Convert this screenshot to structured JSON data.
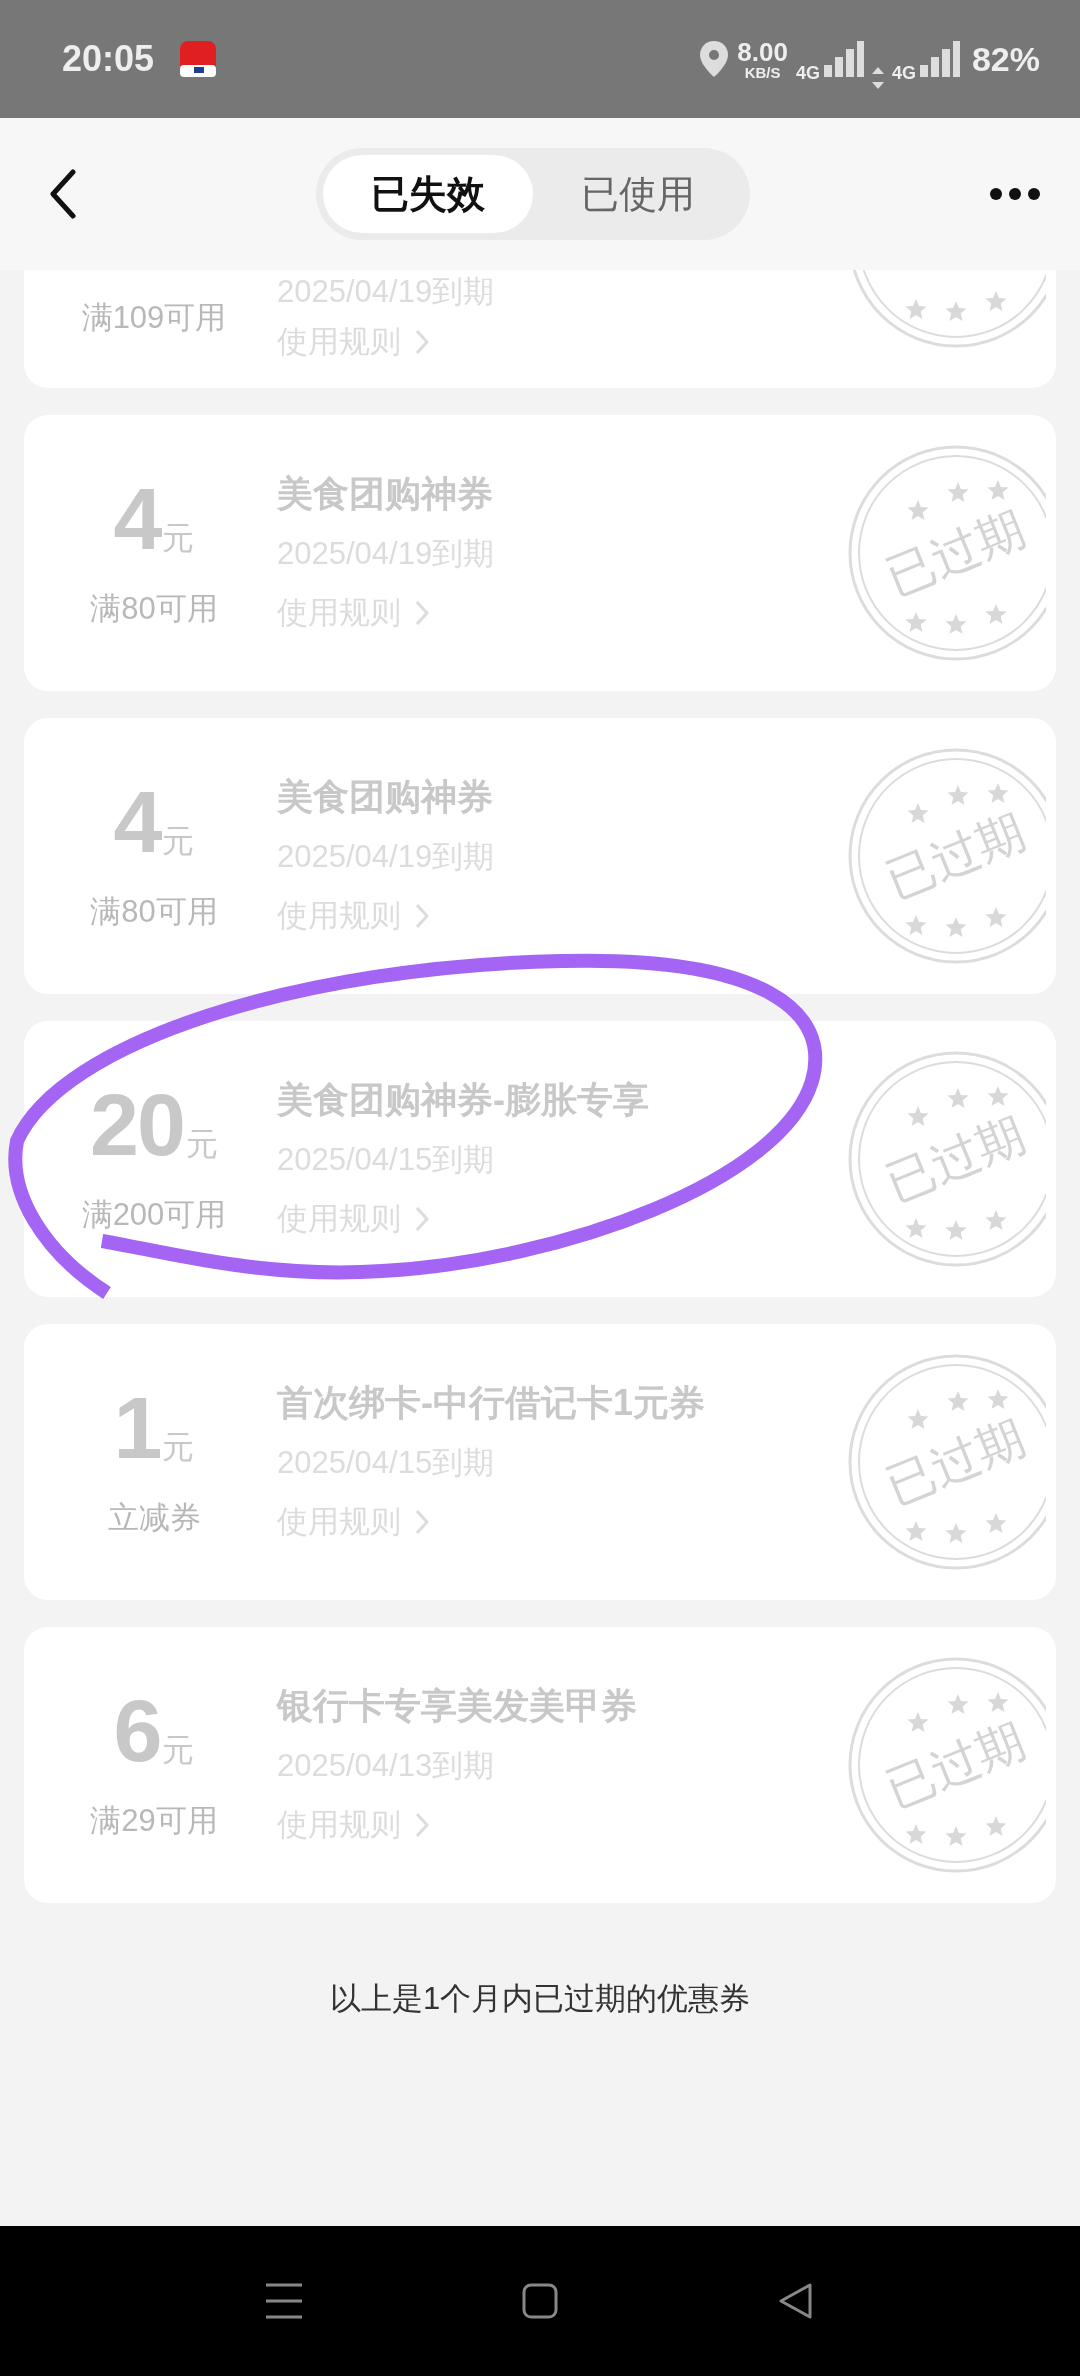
{
  "status_bar": {
    "time": "20:05",
    "net_speed": "8.00",
    "net_unit": "KB/S",
    "sim_1": "4G",
    "sim_2": "4G",
    "battery": "82%"
  },
  "header": {
    "tabs": [
      {
        "label": "已失效",
        "selected": true
      },
      {
        "label": "已使用",
        "selected": false
      }
    ]
  },
  "coupons": [
    {
      "kind": "cut",
      "condition": "满109可用",
      "expiry": "2025/04/19到期",
      "rules": "使用规则",
      "circled": false
    },
    {
      "kind": "full",
      "amount": "4",
      "unit": "元",
      "condition": "满80可用",
      "title": "美食团购神券",
      "expiry": "2025/04/19到期",
      "rules": "使用规则",
      "stamp": "已过期",
      "circled": false
    },
    {
      "kind": "full",
      "amount": "4",
      "unit": "元",
      "condition": "满80可用",
      "title": "美食团购神券",
      "expiry": "2025/04/19到期",
      "rules": "使用规则",
      "stamp": "已过期",
      "circled": false
    },
    {
      "kind": "full",
      "amount": "20",
      "unit": "元",
      "condition": "满200可用",
      "title": "美食团购神券-膨胀专享",
      "expiry": "2025/04/15到期",
      "rules": "使用规则",
      "stamp": "已过期",
      "circled": true
    },
    {
      "kind": "full",
      "amount": "1",
      "unit": "元",
      "condition": "立减券",
      "title": "首次绑卡-中行借记卡1元券",
      "expiry": "2025/04/15到期",
      "rules": "使用规则",
      "stamp": "已过期",
      "circled": false
    },
    {
      "kind": "full",
      "amount": "6",
      "unit": "元",
      "condition": "满29可用",
      "title": "银行卡专享美发美甲券",
      "expiry": "2025/04/13到期",
      "rules": "使用规则",
      "stamp": "已过期",
      "circled": false
    }
  ],
  "footer_note": "以上是1个月内已过期的优惠券"
}
